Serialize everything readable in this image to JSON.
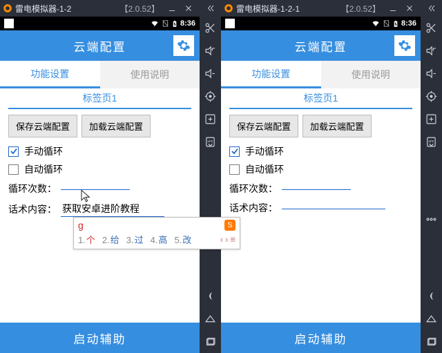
{
  "panes": [
    {
      "titlebar": {
        "title": "雷电模拟器-1-2",
        "version": "【2.0.52】"
      },
      "statusbar": {
        "time": "8:36"
      },
      "header": {
        "title": "云端配置"
      },
      "tabs": {
        "active": "功能设置",
        "inactive": "使用说明"
      },
      "subtab": "标签页1",
      "buttons": {
        "save": "保存云端配置",
        "load": "加载云端配置"
      },
      "checks": {
        "manual": "手动循环",
        "auto": "自动循环",
        "manual_checked": true,
        "auto_checked": false
      },
      "fields": {
        "loop_label": "循环次数：",
        "loop_value": "",
        "talk_label": "话术内容：",
        "talk_value": "获取安卓进阶教程"
      },
      "footer": "启动辅助",
      "ime": {
        "input": "g",
        "candidates": [
          {
            "n": "1",
            "w": "个"
          },
          {
            "n": "2",
            "w": "给"
          },
          {
            "n": "3",
            "w": "过"
          },
          {
            "n": "4",
            "w": "高"
          },
          {
            "n": "5",
            "w": "改"
          }
        ]
      },
      "show_ime": true,
      "show_cursor": true
    },
    {
      "titlebar": {
        "title": "雷电模拟器-1-2-1",
        "version": "【2.0.52】"
      },
      "statusbar": {
        "time": "8:36"
      },
      "header": {
        "title": "云端配置"
      },
      "tabs": {
        "active": "功能设置",
        "inactive": "使用说明"
      },
      "subtab": "标签页1",
      "buttons": {
        "save": "保存云端配置",
        "load": "加载云端配置"
      },
      "checks": {
        "manual": "手动循环",
        "auto": "自动循环",
        "manual_checked": true,
        "auto_checked": false
      },
      "fields": {
        "loop_label": "循环次数：",
        "loop_value": "",
        "talk_label": "话术内容：",
        "talk_value": ""
      },
      "footer": "启动辅助",
      "show_ime": false,
      "show_cursor": false
    }
  ],
  "sidebar_icons": [
    "scissors",
    "volume-up",
    "volume-down",
    "location",
    "add-box",
    "apk",
    "dots",
    "back",
    "home",
    "recent"
  ]
}
